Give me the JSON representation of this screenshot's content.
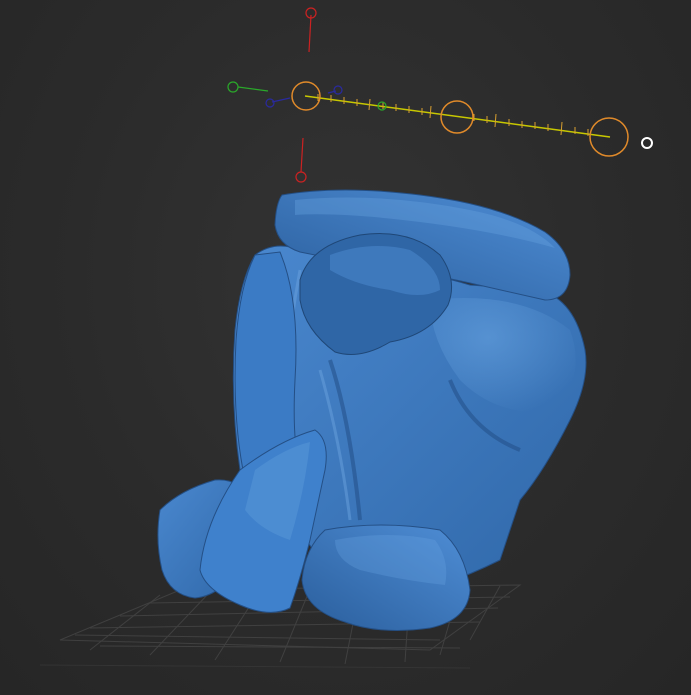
{
  "app": {
    "name": ""
  },
  "viewport": {
    "background_color": "#2b2b2b",
    "floor_grid": {
      "visible": true,
      "color": "#4a4a4a"
    },
    "model": {
      "name": "",
      "shape": "sculpted rock cluster",
      "color": "#3a78c2",
      "shading_light": "#5e9bd9",
      "shading_dark": "#234f86"
    }
  },
  "transpose_gizmo": {
    "axis_colors": {
      "x": "#cc2222",
      "y": "#2aa82a",
      "z": "#2a2aa0"
    },
    "handle_color": "#e08a2a",
    "line_color": "#c8c800",
    "tick_color": "#d9a030",
    "pivot_marker_color": "#ffffff",
    "handles": [
      "start-handle",
      "middle-handle",
      "end-handle"
    ]
  }
}
